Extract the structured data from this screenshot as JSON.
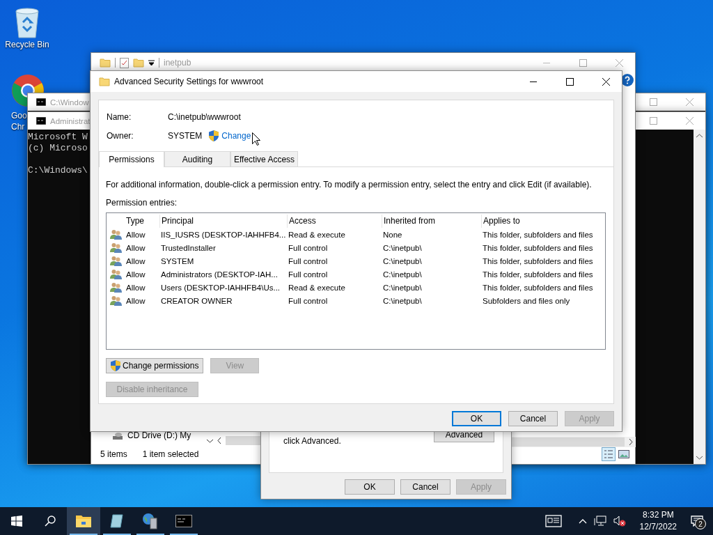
{
  "desktop_icons": [
    {
      "kind": "recycle-bin",
      "lines": [
        "Recycle Bin"
      ]
    },
    {
      "kind": "browser",
      "lines": [
        "Goo",
        "Chr"
      ]
    }
  ],
  "cmd_windows": [
    {
      "title": "C:\\Window"
    },
    {
      "title": "Administrat",
      "blocks": [
        [
          "Microsoft W",
          "(c) Microso"
        ],
        [
          "C:\\Windows\\"
        ]
      ]
    }
  ],
  "explorer": {
    "title": "inetpub",
    "drive_item": "CD Drive (D:) My",
    "status": [
      "5 items",
      "1 item selected"
    ]
  },
  "properties_dialog": {
    "text": "click Advanced.",
    "advanced_button": "Advanced",
    "buttons": [
      {
        "label": "OK",
        "disabled": false
      },
      {
        "label": "Cancel",
        "disabled": false
      },
      {
        "label": "Apply",
        "disabled": true
      }
    ]
  },
  "dialog": {
    "title": "Advanced Security Settings for wwwroot",
    "name_label": "Name:",
    "name_value": "C:\\inetpub\\wwwroot",
    "owner_label": "Owner:",
    "owner_value": "SYSTEM",
    "change_link": "Change",
    "tabs": [
      {
        "label": "Permissions",
        "selected": true
      },
      {
        "label": "Auditing",
        "selected": false
      },
      {
        "label": "Effective Access",
        "selected": false
      }
    ],
    "info": "For additional information, double-click a permission entry. To modify a permission entry, select the entry and click Edit (if available).",
    "entries_label": "Permission entries:",
    "columns": [
      "Type",
      "Principal",
      "Access",
      "Inherited from",
      "Applies to"
    ],
    "rows": [
      [
        "Allow",
        "IIS_IUSRS (DESKTOP-IAHHFB4...",
        "Read & execute",
        "None",
        "This folder, subfolders and files"
      ],
      [
        "Allow",
        "TrustedInstaller",
        "Full control",
        "C:\\inetpub\\",
        "This folder, subfolders and files"
      ],
      [
        "Allow",
        "SYSTEM",
        "Full control",
        "C:\\inetpub\\",
        "This folder, subfolders and files"
      ],
      [
        "Allow",
        "Administrators (DESKTOP-IAH...",
        "Full control",
        "C:\\inetpub\\",
        "This folder, subfolders and files"
      ],
      [
        "Allow",
        "Users (DESKTOP-IAHHFB4\\Us...",
        "Read & execute",
        "C:\\inetpub\\",
        "This folder, subfolders and files"
      ],
      [
        "Allow",
        "CREATOR OWNER",
        "Full control",
        "C:\\inetpub\\",
        "Subfolders and files only"
      ]
    ],
    "list_buttons": [
      {
        "label": "Change permissions",
        "disabled": false,
        "shield": true
      },
      {
        "label": "View",
        "disabled": true,
        "shield": false
      }
    ],
    "inheritance_button": {
      "label": "Disable inheritance",
      "disabled": true
    },
    "footer_buttons": [
      {
        "label": "OK",
        "disabled": false,
        "default": true
      },
      {
        "label": "Cancel",
        "disabled": false,
        "default": false
      },
      {
        "label": "Apply",
        "disabled": true,
        "default": false
      }
    ]
  },
  "taskbar": {
    "apps": [
      {
        "kind": "folder",
        "active": true
      },
      {
        "kind": "notepad",
        "active": false
      },
      {
        "kind": "server",
        "active": false
      },
      {
        "kind": "terminal",
        "active": false
      }
    ],
    "time": "8:32 PM",
    "date": "12/7/2022",
    "notification_count": "2"
  }
}
